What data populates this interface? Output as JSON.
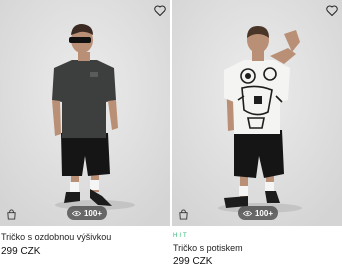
{
  "products": [
    {
      "name": "Tričko s ozdobnou výšivkou",
      "price": "299 CZK",
      "views": "100+",
      "badge": "",
      "favorite_icon": "heart-outline-icon",
      "bag_icon": "shopping-bag-icon",
      "image": "model-black-tshirt-shorts"
    },
    {
      "name": "Tričko s potiskem",
      "price": "299 CZK",
      "views": "100+",
      "badge": "HIT",
      "favorite_icon": "heart-outline-icon",
      "bag_icon": "shopping-bag-icon",
      "image": "model-white-printed-tshirt-back"
    }
  ],
  "colors": {
    "badge": "#2bb673",
    "views_pill": "#3c3c3c"
  }
}
